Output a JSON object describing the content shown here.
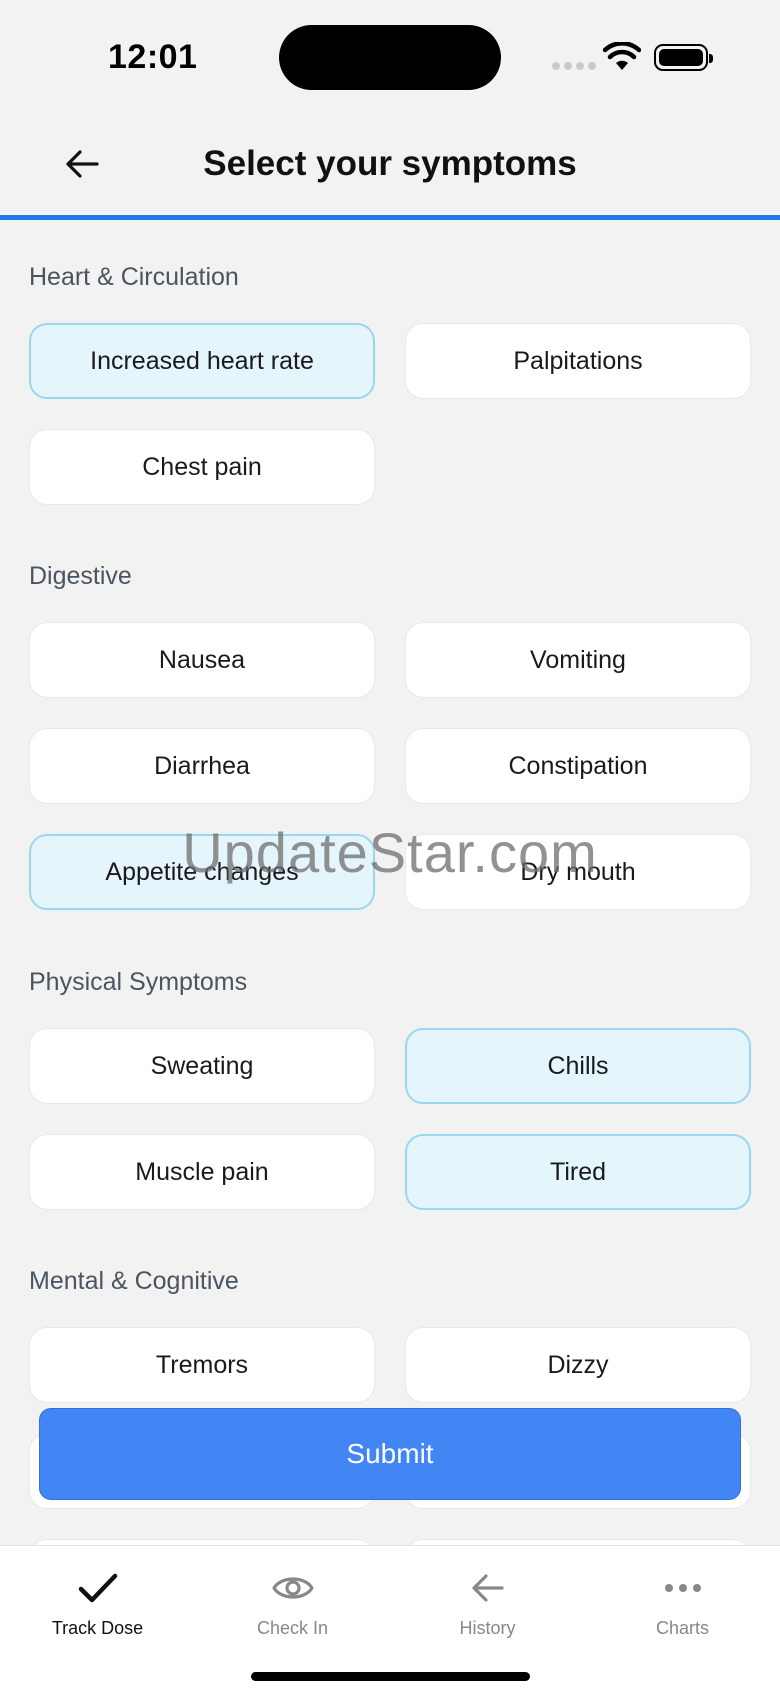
{
  "status_bar": {
    "time": "12:01"
  },
  "header": {
    "title": "Select your symptoms"
  },
  "sections": [
    {
      "title": "Heart & Circulation",
      "items": [
        {
          "label": "Increased heart rate",
          "selected": true
        },
        {
          "label": "Palpitations",
          "selected": false
        },
        {
          "label": "Chest pain",
          "selected": false
        }
      ]
    },
    {
      "title": "Digestive",
      "items": [
        {
          "label": "Nausea",
          "selected": false
        },
        {
          "label": "Vomiting",
          "selected": false
        },
        {
          "label": "Diarrhea",
          "selected": false
        },
        {
          "label": "Constipation",
          "selected": false
        },
        {
          "label": "Appetite changes",
          "selected": true
        },
        {
          "label": "Dry mouth",
          "selected": false
        }
      ]
    },
    {
      "title": "Physical Symptoms",
      "items": [
        {
          "label": "Sweating",
          "selected": false
        },
        {
          "label": "Chills",
          "selected": true
        },
        {
          "label": "Muscle pain",
          "selected": false
        },
        {
          "label": "Tired",
          "selected": true
        }
      ]
    },
    {
      "title": "Mental & Cognitive",
      "items": [
        {
          "label": "Tremors",
          "selected": false
        },
        {
          "label": "Dizzy",
          "selected": false
        }
      ]
    }
  ],
  "watermark": "UpdateStar.com",
  "submit_label": "Submit",
  "nav": [
    {
      "label": "Track Dose",
      "icon": "checkmark-icon",
      "active": true
    },
    {
      "label": "Check In",
      "icon": "eye-icon",
      "active": false
    },
    {
      "label": "History",
      "icon": "arrow-left-icon",
      "active": false
    },
    {
      "label": "Charts",
      "icon": "more-horizontal-icon",
      "active": false
    }
  ],
  "colors": {
    "accent": "#4285f4",
    "header_line": "#1e7ae6",
    "selected_bg": "#e5f5fc",
    "selected_border": "#99d7f0"
  }
}
